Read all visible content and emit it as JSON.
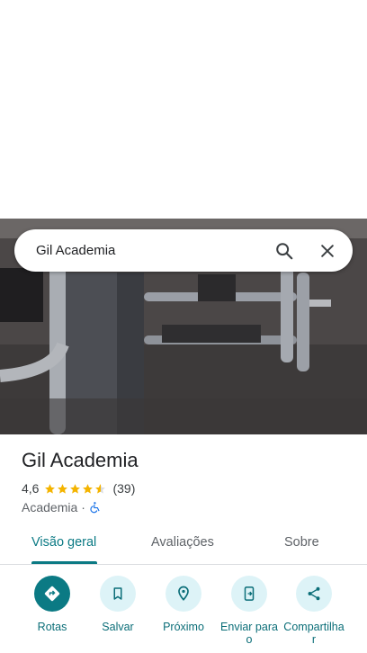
{
  "search": {
    "query": "Gil Academia"
  },
  "place": {
    "name": "Gil Academia",
    "rating": "4,6",
    "rating_value": 4.6,
    "reviews": "(39)",
    "category": "Academia",
    "separator": "·"
  },
  "tabs": [
    {
      "label": "Visão geral"
    },
    {
      "label": "Avaliações"
    },
    {
      "label": "Sobre"
    }
  ],
  "actions": [
    {
      "label": "Rotas",
      "icon": "directions-icon"
    },
    {
      "label": "Salvar",
      "icon": "bookmark-icon"
    },
    {
      "label": "Próximo",
      "icon": "nearby-icon"
    },
    {
      "label": "Enviar para o",
      "icon": "send-to-phone-icon"
    },
    {
      "label": "Compartilha r",
      "icon": "share-icon"
    }
  ],
  "colors": {
    "accent": "#0b7a84",
    "chip": "#ddf3f7",
    "star": "#f4b400"
  }
}
